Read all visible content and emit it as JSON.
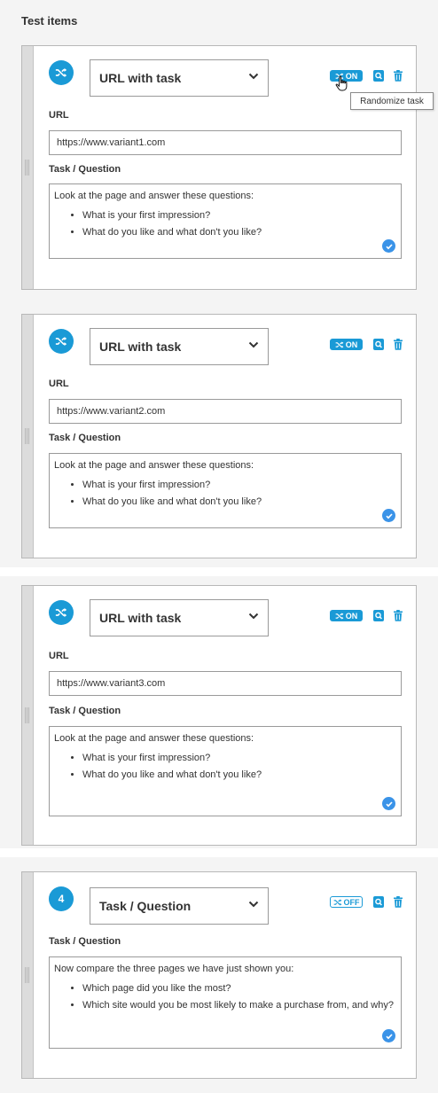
{
  "section_title": "Test items",
  "accent_color": "#1a9ad6",
  "tooltip": "Randomize task",
  "items": [
    {
      "badge_icon": "shuffle-icon",
      "type": "URL with task",
      "toggle": "ON",
      "url_label": "URL",
      "url": "https://www.variant1.com",
      "task_label": "Task / Question",
      "task_intro": "Look at the page and answer these questions:",
      "questions": [
        "What is your first impression?",
        "What do you like and what don't you like?"
      ]
    },
    {
      "badge_icon": "shuffle-icon",
      "type": "URL with task",
      "toggle": "ON",
      "url_label": "URL",
      "url": "https://www.variant2.com",
      "task_label": "Task / Question",
      "task_intro": "Look at the page and answer these questions:",
      "questions": [
        "What is your first impression?",
        "What do you like and what don't you like?"
      ]
    },
    {
      "badge_icon": "shuffle-icon",
      "type": "URL with task",
      "toggle": "ON",
      "url_label": "URL",
      "url": "https://www.variant3.com",
      "task_label": "Task / Question",
      "task_intro": "Look at the page and answer these questions:",
      "questions": [
        "What is your first impression?",
        "What do you like and what don't you like?"
      ]
    },
    {
      "badge": "4",
      "type": "Task / Question",
      "toggle": "OFF",
      "task_label": "Task / Question",
      "task_intro": "Now compare the three pages we have just shown you:",
      "questions": [
        "Which page did you like the most?",
        "Which site would you be most likely to make a purchase from, and why?"
      ]
    }
  ]
}
